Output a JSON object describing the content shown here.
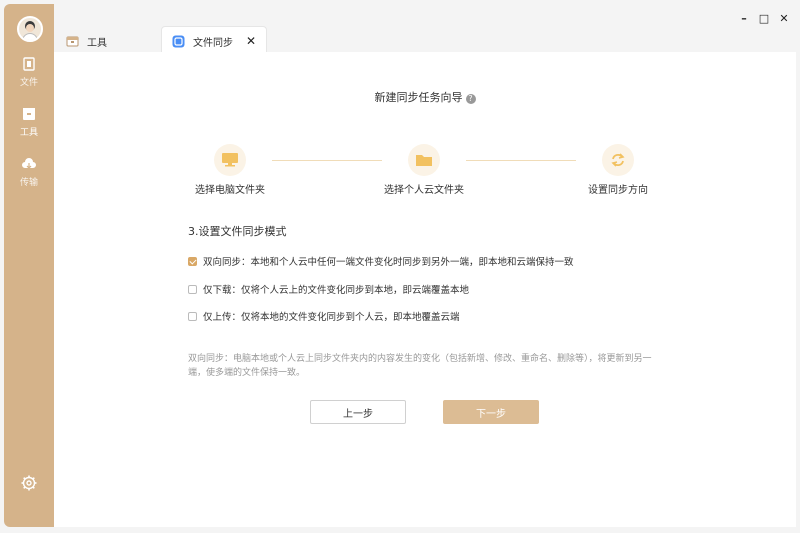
{
  "sidebar": {
    "items": [
      {
        "label": "文件",
        "icon": "file-icon"
      },
      {
        "label": "工具",
        "icon": "toolbox-icon"
      },
      {
        "label": "传输",
        "icon": "cloud-transfer-icon"
      }
    ],
    "settings_icon": "gear-icon"
  },
  "tabs": [
    {
      "label": "工具",
      "icon": "toolbox-icon",
      "active": false
    },
    {
      "label": "文件同步",
      "icon": "sync-app-icon",
      "active": true,
      "close": "✕"
    }
  ],
  "window_controls": {
    "minimize": "–",
    "maximize": "□",
    "close": "✕"
  },
  "wizard": {
    "title": "新建同步任务向导",
    "help": "?",
    "steps": [
      {
        "label": "选择电脑文件夹",
        "icon": "monitor-icon"
      },
      {
        "label": "选择个人云文件夹",
        "icon": "folder-icon"
      },
      {
        "label": "设置同步方向",
        "icon": "sync-icon"
      }
    ],
    "section_title": "3.设置文件同步模式",
    "options": [
      {
        "label": "双向同步：本地和个人云中任何一端文件变化时同步到另外一端，即本地和云端保持一致",
        "checked": true
      },
      {
        "label": "仅下载：仅将个人云上的文件变化同步到本地，即云端覆盖本地",
        "checked": false
      },
      {
        "label": "仅上传：仅将本地的文件变化同步到个人云，即本地覆盖云端",
        "checked": false
      }
    ],
    "description": "双向同步：电脑本地或个人云上同步文件夹内的内容发生的变化（包括新增、修改、重命名、删除等），将更新到另一端，使多端的文件保持一致。",
    "prev_button": "上一步",
    "next_button": "下一步"
  },
  "colors": {
    "sidebar": "#d5b38a",
    "accent": "#d9a866",
    "next_button": "#dcbc94",
    "step_circle": "#fbf3e6"
  }
}
